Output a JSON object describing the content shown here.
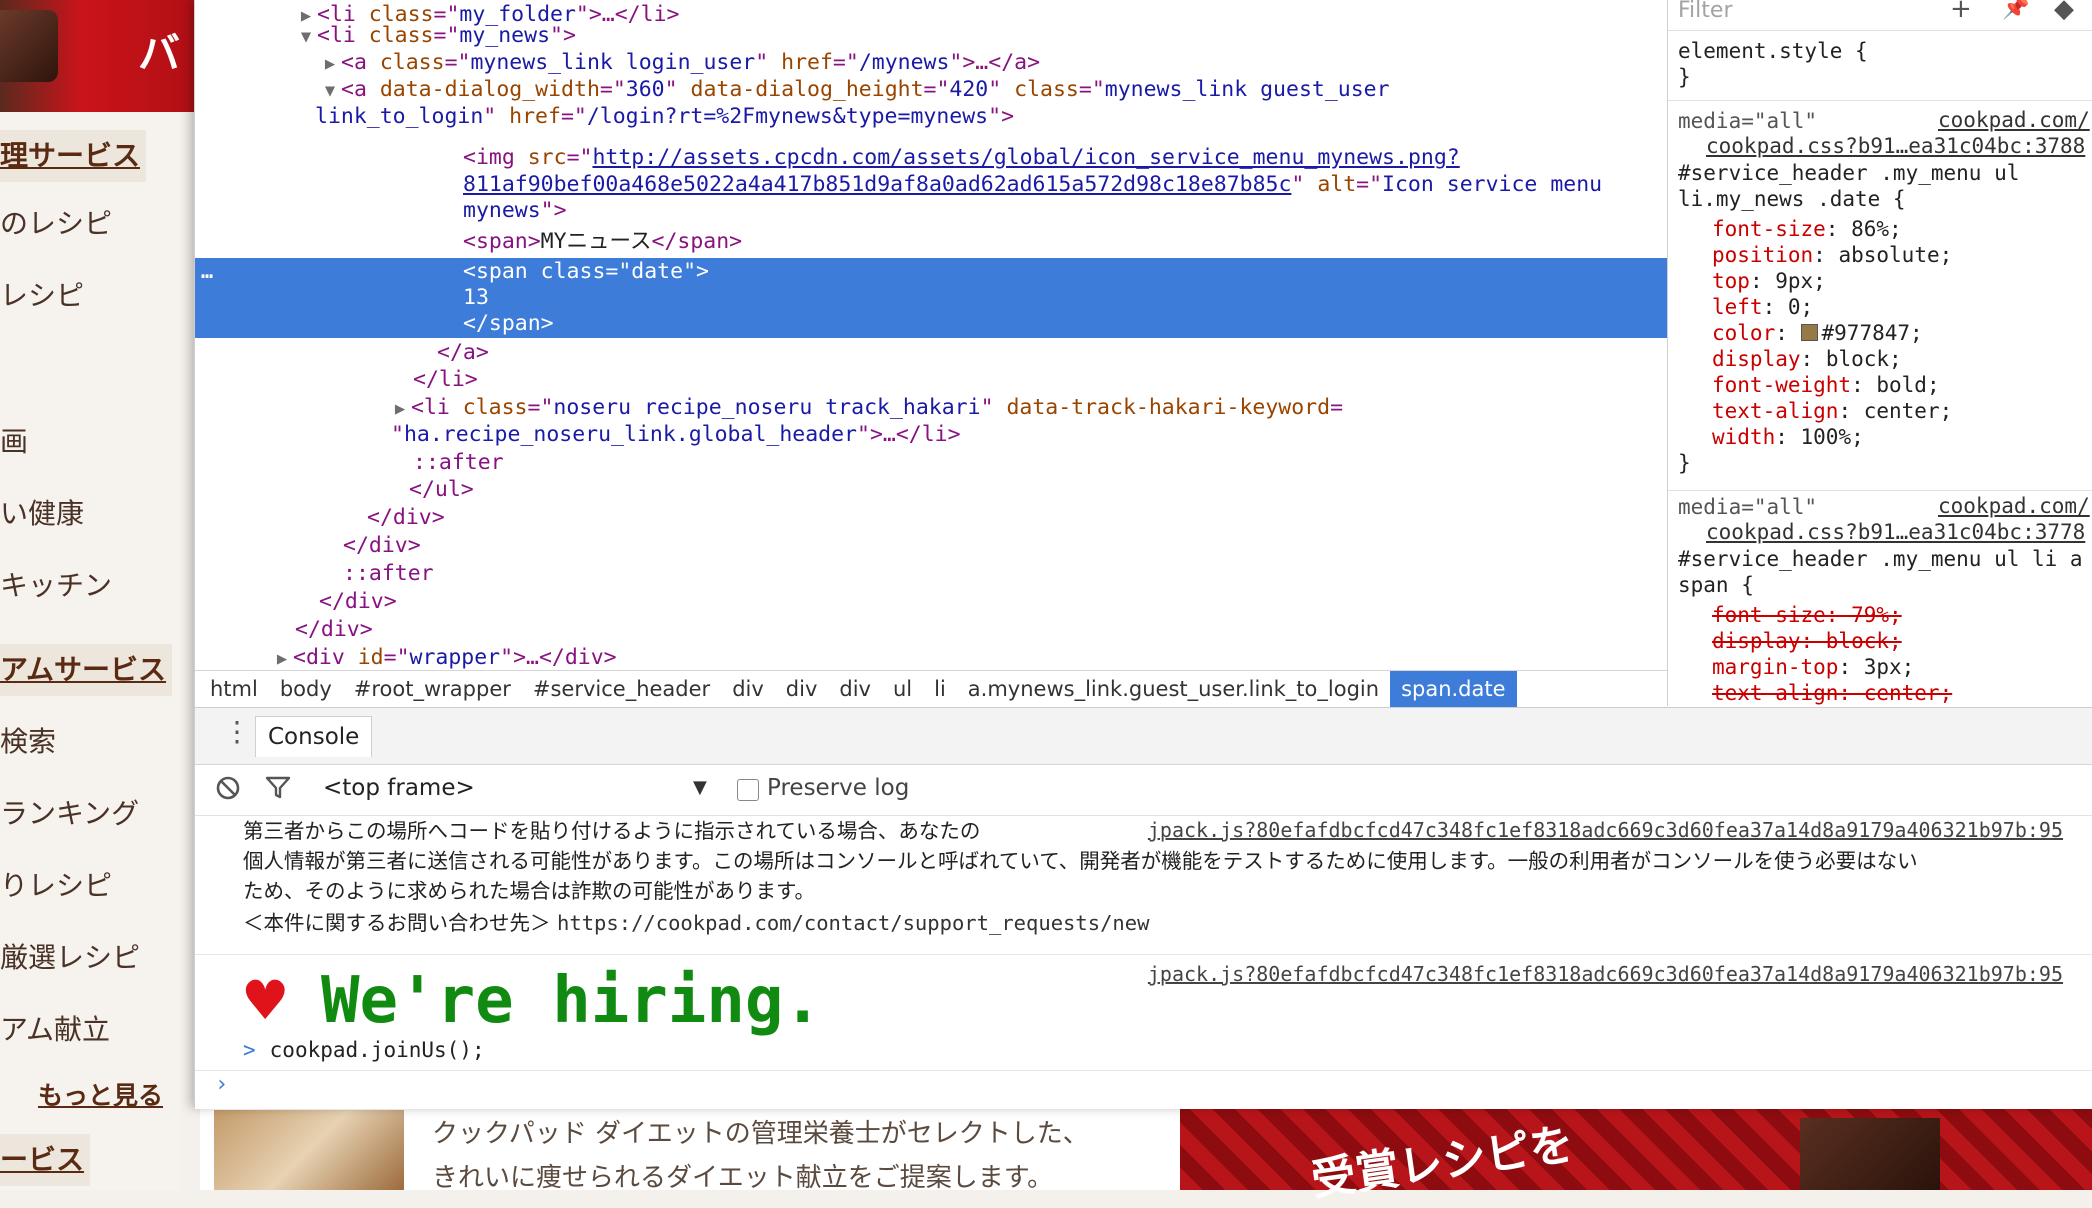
{
  "background": {
    "banner_text": "バ",
    "sidebar": [
      {
        "label": "理サービス",
        "kind": "head"
      },
      {
        "label": "のレシピ",
        "kind": "item"
      },
      {
        "label": "レシピ",
        "kind": "item"
      },
      {
        "label": "画",
        "kind": "item"
      },
      {
        "label": "い健康",
        "kind": "item"
      },
      {
        "label": "キッチン",
        "kind": "item"
      },
      {
        "label": "アムサービス",
        "kind": "head"
      },
      {
        "label": "検索",
        "kind": "item"
      },
      {
        "label": "ランキング",
        "kind": "item"
      },
      {
        "label": "りレシピ",
        "kind": "item"
      },
      {
        "label": "厳選レシピ",
        "kind": "item"
      },
      {
        "label": "アム献立",
        "kind": "item"
      },
      {
        "label": "もっと見る",
        "kind": "more"
      },
      {
        "label": "ービス",
        "kind": "head"
      }
    ],
    "desc_line1": "クックパッド ダイエットの管理栄養士がセレクトした、",
    "desc_line2": "きれいに痩せられるダイエット献立をご提案します。",
    "ad_text": "受賞レシピを"
  },
  "elements": {
    "lines": [
      {
        "n": 0,
        "tri": "▶",
        "t1": "<li ",
        "a1": "class",
        "e1": "=\"",
        "v1": "my_folder",
        "t2": "\">…</li>"
      },
      {
        "n": 1,
        "tri": "▼",
        "t1": "<li ",
        "a1": "class",
        "e1": "=\"",
        "v1": "my_news",
        "t2": "\">"
      },
      {
        "n": 2,
        "tri": "▶",
        "t1": "<a ",
        "a1": "class",
        "e1": "=\"",
        "v1": "mynews_link login_user",
        "e2": "\" ",
        "a2": "href",
        "e3": "=\"",
        "v2": "/mynews",
        "t2": "\">…</a>"
      },
      {
        "n": 3,
        "tri": "▼",
        "t1": "<a ",
        "a1": "data-dialog_width",
        "e1": "=\"",
        "v1": "360",
        "e2": "\" ",
        "a2": "data-dialog_height",
        "e3": "=\"",
        "v2": "420",
        "e4": "\" ",
        "a3": "class",
        "e5": "=\"",
        "v3": "mynews_link guest_user"
      },
      {
        "n": 4,
        "v1": "link_to_login",
        "e1": "\" ",
        "a1": "href",
        "e2": "=\"",
        "v2": "/login?rt=%2Fmynews&type=mynews",
        "t2": "\">"
      },
      {
        "n": 5,
        "t1": "<img ",
        "a1": "src",
        "e1": "=\"",
        "link": "http://assets.cpcdn.com/assets/global/icon_service_menu_mynews.png?"
      },
      {
        "n": 6,
        "link": "811af90bef00a468e5022a4a417b851d9af8a0ad62ad615a572d98c18e87b85c",
        "e1": "\" ",
        "a1": "alt",
        "e2": "=\"",
        "v1": "Icon service menu"
      },
      {
        "n": 7,
        "v1": "mynews",
        "t2": "\">"
      },
      {
        "n": 8,
        "t1": "<span>",
        "text": "MYニュース",
        "t2": "</span>"
      },
      {
        "n": 9,
        "t1": "<span ",
        "a1": "class",
        "e1": "=\"",
        "v1": "date",
        "t2": "\">"
      },
      {
        "n": 10,
        "text": "13"
      },
      {
        "n": 11,
        "t1": "</span>"
      },
      {
        "n": 12,
        "t1": "</a>"
      },
      {
        "n": 13,
        "t1": "</li>"
      },
      {
        "n": 14,
        "tri": "▶",
        "t1": "<li ",
        "a1": "class",
        "e1": "=\"",
        "v1": "noseru recipe_noseru track_hakari",
        "e2": "\" ",
        "a2": "data-track-hakari-keyword",
        "e3": "="
      },
      {
        "n": 15,
        "e1": "\"",
        "v1": "ha.recipe_noseru_link.global_header",
        "t2": "\">…</li>"
      },
      {
        "n": 16,
        "pseudo": "::after"
      },
      {
        "n": 17,
        "t1": "</ul>"
      },
      {
        "n": 18,
        "t1": "</div>"
      },
      {
        "n": 19,
        "t1": "</div>"
      },
      {
        "n": 20,
        "pseudo": "::after"
      },
      {
        "n": 21,
        "t1": "</div>"
      },
      {
        "n": 22,
        "t1": "</div>"
      },
      {
        "n": 23,
        "tri": "▶",
        "t1": "<div ",
        "a1": "id",
        "e1": "=\"",
        "v1": "wrapper",
        "t2": "\">…</div>"
      }
    ],
    "selected_ellipsis": "…",
    "breadcrumb": [
      "html",
      "body",
      "#root_wrapper",
      "#service_header",
      "div",
      "div",
      "div",
      "ul",
      "li",
      "a.mynews_link.guest_user.link_to_login",
      "span.date"
    ],
    "breadcrumb_active": "span.date"
  },
  "styles": {
    "filter_placeholder": "Filter",
    "element_style_open": "element.style {",
    "element_style_close": "}",
    "rule1": {
      "media": "media=\"all\"",
      "src1": "cookpad.com/",
      "src2": "cookpad.css?b91…ea31c04bc:3788",
      "selector1": "#service_header .my_menu ul",
      "selector2": "li.my_news .date {",
      "props": [
        {
          "name": "font-size",
          "value": " 86%;"
        },
        {
          "name": "position",
          "value": " absolute;"
        },
        {
          "name": "top",
          "value": " 9px;"
        },
        {
          "name": "left",
          "value": " 0;"
        },
        {
          "name": "color",
          "value": "#977847;",
          "swatch": "#977847"
        },
        {
          "name": "display",
          "value": " block;"
        },
        {
          "name": "font-weight",
          "value": " bold;"
        },
        {
          "name": "text-align",
          "value": " center;"
        },
        {
          "name": "width",
          "value": " 100%;"
        }
      ],
      "close": "}"
    },
    "rule2": {
      "media": "media=\"all\"",
      "src1": "cookpad.com/",
      "src2": "cookpad.css?b91…ea31c04bc:3778",
      "selector1": "#service_header .my_menu ul li a",
      "selector2": "span {",
      "props": [
        {
          "text": "font-size: 79%;",
          "struck": true
        },
        {
          "text": "display: block;",
          "struck": true
        },
        {
          "name": "margin-top",
          "value": " 3px;"
        },
        {
          "text": "text-align: center;",
          "struck": true
        }
      ]
    }
  },
  "console": {
    "tab_label": "Console",
    "frame": "<top frame>",
    "preserve_log": "Preserve log",
    "warning_line1": "第三者からこの場所へコードを貼り付けるように指示されている場合、あなたの",
    "warning_line2": "個人情報が第三者に送信される可能性があります。この場所はコンソールと呼ばれていて、開発者が機能をテストするために使用します。一般の利用者がコンソールを使う必要はない",
    "warning_line3": "ため、そのように求められた場合は詐欺の可能性があります。",
    "warning_line4_prefix": "＜本件に関するお問い合わせ先＞ ",
    "warning_url": "https://cookpad.com/contact/support_requests/new",
    "source1": "jpack.js?80efafdbcfcd47c348fc1ef8318adc669c3d60fea37a14d8a9179a406321b97b:95",
    "heart": "♥",
    "hiring": "We're hiring.",
    "source2": "jpack.js?80efafdbcfcd47c348fc1ef8318adc669c3d60fea37a14d8a9179a406321b97b:95",
    "command_chevron": ">",
    "command": "cookpad.joinUs();",
    "prompt": "›"
  }
}
